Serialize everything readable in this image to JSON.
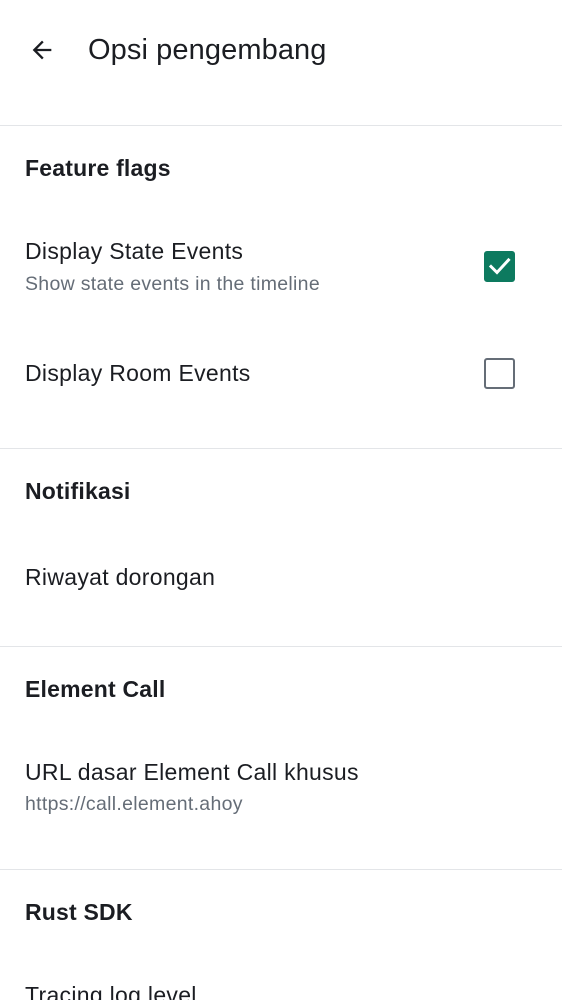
{
  "header": {
    "title": "Opsi pengembang",
    "back_icon": "arrow-left-icon"
  },
  "sections": {
    "feature_flags": {
      "title": "Feature flags",
      "items": [
        {
          "title": "Display State Events",
          "subtitle": "Show state events in the timeline",
          "checked": true
        },
        {
          "title": "Display Room Events",
          "checked": false
        }
      ]
    },
    "notifications": {
      "title": "Notifikasi",
      "items": [
        {
          "title": "Riwayat dorongan"
        }
      ]
    },
    "element_call": {
      "title": "Element Call",
      "items": [
        {
          "title": "URL dasar Element Call khusus",
          "value": "https://call.element.ahoy"
        }
      ]
    },
    "rust_sdk": {
      "title": "Rust SDK",
      "items": [
        {
          "title": "Tracing log level"
        }
      ]
    }
  },
  "colors": {
    "accent": "#0d7a5f",
    "text_primary": "#1b1d22",
    "text_secondary": "#656d77",
    "divider": "#e3e5e8"
  }
}
